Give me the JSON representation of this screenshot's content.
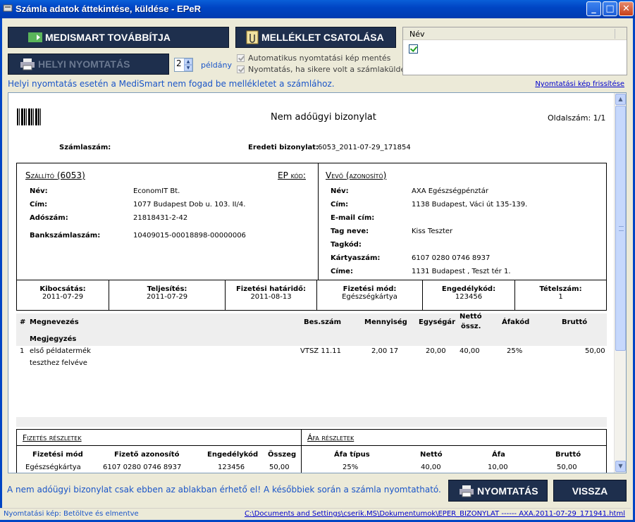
{
  "window": {
    "title": "Számla adatok áttekintése, küldése - EPeR"
  },
  "toolbar": {
    "medismart_label": "MEDISMART TOVÁBBÍTJA",
    "melleklet_label": "MELLÉKLET CSATOLÁSA",
    "helyi_label": "HELYI NYOMTATÁS",
    "copies_value": "2",
    "copies_unit": "példány",
    "chk_auto_label": "Automatikus nyomtatási kép mentés",
    "chk_print_label": "Nyomtatás, ha sikere volt a számlaküldés"
  },
  "nev_list": {
    "header": "Név",
    "checked": true
  },
  "info_text": "Helyi nyomtatás esetén a MediSmart nem fogad be mellékletet a számlához.",
  "refresh_link": "Nyomtatási kép frissítése",
  "doc": {
    "title": "Nem adóügyi bizonylat",
    "page_label": "Oldalszám: 1/1",
    "szamlaszam_label": "Számlaszám:",
    "eredeti_label": "Eredeti bizonylat:",
    "eredeti_value": "6053_2011-07-29_171854",
    "szallito": {
      "heading": "Szállító (6053)",
      "ep_kod": "EP kód:",
      "labels": [
        "Név:",
        "Cím:",
        "Adószám:",
        "Bankszámlaszám:"
      ],
      "values": [
        "EconomIT Bt.",
        "1077 Budapest Dob u. 103. II/4.",
        "21818431-2-42",
        "10409015-00018898-00000006"
      ]
    },
    "vevo": {
      "heading": "Vevő (azonosító)",
      "labels": [
        "Név:",
        "Cím:",
        "E-mail cím:",
        "Tag neve:",
        "Tagkód:",
        "Kártyaszám:",
        "Címe:"
      ],
      "values": [
        "AXA Egészségpénztár",
        "1138 Budapest, Váci út 135-139.",
        "",
        "Kiss Teszter",
        "",
        "6107 0280 0746 8937",
        "1131 Budapest , Teszt tér 1."
      ]
    },
    "dates": [
      {
        "label": "Kibocsátás:",
        "value": "2011-07-29"
      },
      {
        "label": "Teljesítés:",
        "value": "2011-07-29"
      },
      {
        "label": "Fizetési határidő:",
        "value": "2011-08-13"
      },
      {
        "label": "Fizetési mód:",
        "value": "Egészségkártya"
      },
      {
        "label": "Engedélykód:",
        "value": "123456"
      },
      {
        "label": "Tételszám:",
        "value": "1"
      }
    ],
    "items_header": {
      "hash": "#",
      "megnevezes": "Megnevezés",
      "besszam": "Bes.szám",
      "mennyiseg": "Mennyiség",
      "egysegar": "Egységár",
      "netto1": "Nettó",
      "netto2": "össz.",
      "afakod": "Áfakód",
      "brutto": "Bruttó",
      "megjegyzes": "Megjegyzés"
    },
    "item": {
      "no": "1",
      "name1": "első példatermék",
      "name2": "teszthez felvéve",
      "besszam": "VTSZ 11.11",
      "mennyiseg": "2,00 17",
      "egysegar": "20,00",
      "netto": "40,00",
      "afakod": "25%",
      "brutto": "50,00"
    },
    "fizetes": {
      "heading": "Fizetés részletek",
      "cols": [
        "Fizetési mód",
        "Fizető azonosító",
        "Engedélykód",
        "Összeg"
      ],
      "row": [
        "Egészségkártya",
        "6107 0280 0746 8937",
        "123456",
        "50,00"
      ]
    },
    "afa": {
      "heading": "Áfa részletek",
      "cols": [
        "Áfa típus",
        "Nettó",
        "Áfa",
        "Bruttó"
      ],
      "row": [
        "25%",
        "40,00",
        "10,00",
        "50,00"
      ]
    }
  },
  "bottom_text": "A nem adóügyi bizonylat csak ebben az ablakban érhető el! A későbbiek során a számla nyomtatható.",
  "btn_nyomtatas": "NYOMTATÁS",
  "btn_vissza": "VISSZA",
  "status": {
    "left": "Nyomtatási kép:  Betöltve és elmentve",
    "path": "C:\\Documents and Settings\\cserik.MS\\Dokumentumok\\EPER_BIZONYLAT ------ AXA.2011-07-29_171941.html"
  }
}
